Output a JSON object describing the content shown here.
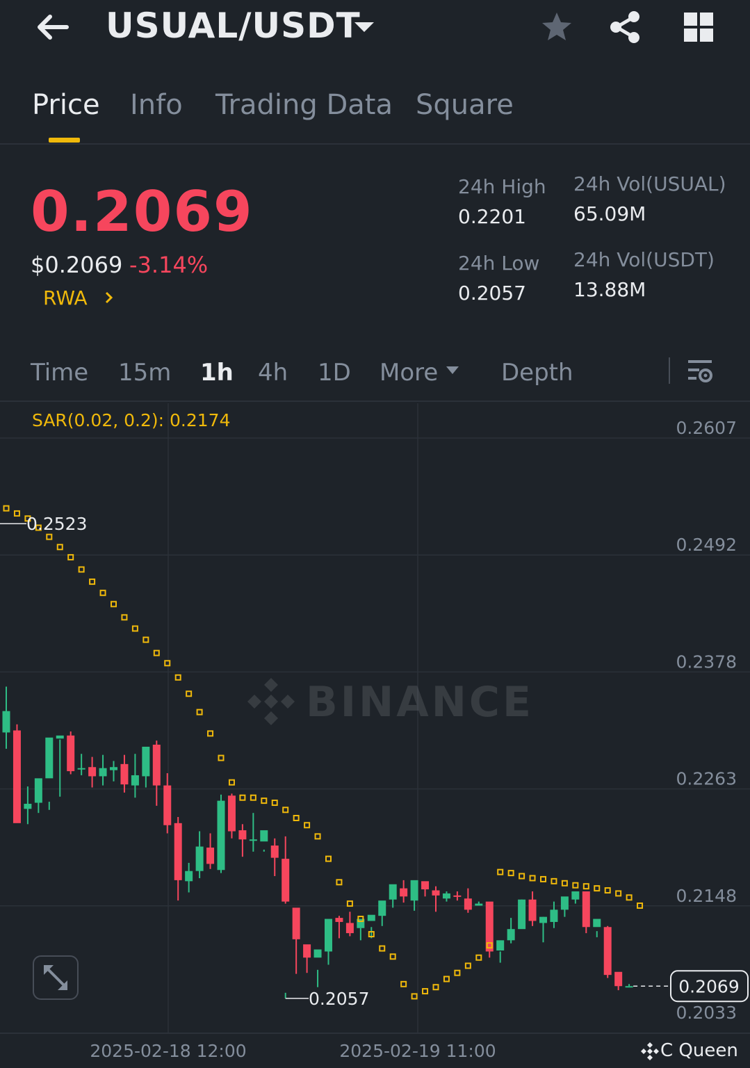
{
  "header": {
    "pair": "USUAL/USDT",
    "icons": [
      "back-arrow-icon",
      "caret-down-icon",
      "star-icon",
      "share-icon",
      "grid-icon"
    ]
  },
  "tabs": [
    {
      "label": "Price",
      "active": true
    },
    {
      "label": "Info",
      "active": false
    },
    {
      "label": "Trading Data",
      "active": false
    },
    {
      "label": "Square",
      "active": false
    }
  ],
  "ticker": {
    "last_price": "0.2069",
    "usd_price": "$0.2069",
    "change": "-3.14%",
    "tag": "RWA",
    "high_label": "24h High",
    "high_value": "0.2201",
    "low_label": "24h Low",
    "low_value": "0.2057",
    "vol_base_label": "24h Vol(USUAL)",
    "vol_base_value": "65.09M",
    "vol_quote_label": "24h Vol(USDT)",
    "vol_quote_value": "13.88M"
  },
  "intervals": [
    {
      "label": "Time",
      "active": false
    },
    {
      "label": "15m",
      "active": false
    },
    {
      "label": "1h",
      "active": true
    },
    {
      "label": "4h",
      "active": false
    },
    {
      "label": "1D",
      "active": false
    },
    {
      "label": "More",
      "active": false
    },
    {
      "label": "Depth",
      "active": false
    }
  ],
  "colors": {
    "up": "#2ebd85",
    "down": "#f6465d",
    "accent": "#f0b90b",
    "background": "#1e2329",
    "grid": "#2b3139",
    "muted": "#848e9c"
  },
  "chart_data": {
    "type": "candlestick",
    "indicator_label": "SAR(0.02, 0.2): 0.2174",
    "watermark": "BINANCE",
    "credit": "C Queen",
    "y_ticks": [
      "0.2607",
      "0.2492",
      "0.2378",
      "0.2263",
      "0.2148",
      "0.2033"
    ],
    "ylim": [
      0.2033,
      0.2607
    ],
    "x_ticks": [
      "2025-02-18 12:00",
      "2025-02-19 11:00"
    ],
    "max_marker": "0.2523",
    "min_marker": "0.2057",
    "last_price_label": "0.2069",
    "candles": [
      [
        0.2318,
        0.2363,
        0.2339,
        0.2302
      ],
      [
        0.232,
        0.2326,
        0.2229,
        0.2244
      ],
      [
        0.2243,
        0.2265,
        0.2248,
        0.2228
      ],
      [
        0.2249,
        0.225,
        0.2273,
        0.2239
      ],
      [
        0.2273,
        0.225,
        0.2313,
        0.2242
      ],
      [
        0.2312,
        0.2311,
        0.2315,
        0.2255
      ],
      [
        0.2315,
        0.2319,
        0.228,
        0.2277
      ],
      [
        0.2282,
        0.2297,
        0.2283,
        0.2276
      ],
      [
        0.2284,
        0.2294,
        0.2275,
        0.2264
      ],
      [
        0.2275,
        0.2296,
        0.2283,
        0.2266
      ],
      [
        0.2281,
        0.229,
        0.2284,
        0.227
      ],
      [
        0.2287,
        0.2296,
        0.2267,
        0.2259
      ],
      [
        0.2266,
        0.2297,
        0.2276,
        0.2254
      ],
      [
        0.2275,
        0.2295,
        0.2304,
        0.2264
      ],
      [
        0.2306,
        0.231,
        0.2266,
        0.2246
      ],
      [
        0.2266,
        0.2278,
        0.2227,
        0.2219
      ],
      [
        0.2229,
        0.2235,
        0.2173,
        0.2153
      ],
      [
        0.2172,
        0.219,
        0.2182,
        0.2161
      ],
      [
        0.2182,
        0.2221,
        0.2206,
        0.2175
      ],
      [
        0.2205,
        0.2219,
        0.2189,
        0.2184
      ],
      [
        0.2183,
        0.2257,
        0.2251,
        0.218
      ],
      [
        0.2256,
        0.2258,
        0.2221,
        0.2214
      ],
      [
        0.2222,
        0.2228,
        0.2213,
        0.2196
      ],
      [
        0.2213,
        0.2239,
        0.2213,
        0.2201
      ],
      [
        0.2211,
        0.2201,
        0.2222,
        0.2203
      ],
      [
        0.2207,
        0.2214,
        0.2195,
        0.2177
      ],
      [
        0.2194,
        0.2216,
        0.2152,
        0.215
      ],
      [
        0.2146,
        0.2138,
        0.2115,
        0.2081
      ],
      [
        0.211,
        0.2105,
        0.2097,
        0.2082
      ],
      [
        0.2097,
        0.2085,
        0.2105,
        0.2068
      ],
      [
        0.2103,
        0.2123,
        0.2135,
        0.209
      ],
      [
        0.2136,
        0.2138,
        0.2132,
        0.2116
      ],
      [
        0.2131,
        0.2142,
        0.2121,
        0.2118
      ],
      [
        0.2126,
        0.2126,
        0.2135,
        0.2114
      ],
      [
        0.2133,
        0.2127,
        0.2139,
        0.2116
      ],
      [
        0.2138,
        0.2147,
        0.2153,
        0.2128
      ],
      [
        0.2154,
        0.2157,
        0.2169,
        0.2146
      ],
      [
        0.2165,
        0.2173,
        0.2157,
        0.2151
      ],
      [
        0.2153,
        0.2163,
        0.2173,
        0.2143
      ],
      [
        0.2172,
        0.2169,
        0.2164,
        0.2157
      ],
      [
        0.2163,
        0.2167,
        0.2158,
        0.2142
      ],
      [
        0.2155,
        0.2162,
        0.216,
        0.2152
      ],
      [
        0.2158,
        0.2162,
        0.2157,
        0.2153
      ],
      [
        0.2155,
        0.2165,
        0.2144,
        0.2141
      ],
      [
        0.2148,
        0.2152,
        0.215,
        0.2148
      ],
      [
        0.2152,
        0.2151,
        0.2103,
        0.2097
      ],
      [
        0.2104,
        0.2103,
        0.2114,
        0.2092
      ],
      [
        0.2114,
        0.2136,
        0.2125,
        0.2111
      ],
      [
        0.2125,
        0.2154,
        0.2154,
        0.2135
      ],
      [
        0.2154,
        0.2162,
        0.2133,
        0.2128
      ],
      [
        0.2131,
        0.2137,
        0.2137,
        0.2112
      ],
      [
        0.2132,
        0.2152,
        0.2144,
        0.2126
      ],
      [
        0.2144,
        0.2149,
        0.2157,
        0.2137
      ],
      [
        0.2154,
        0.2155,
        0.2162,
        0.215
      ],
      [
        0.2162,
        0.2161,
        0.2127,
        0.2121
      ],
      [
        0.2127,
        0.2123,
        0.2135,
        0.2117
      ],
      [
        0.2127,
        0.2128,
        0.208,
        0.2077
      ],
      [
        0.2083,
        0.2081,
        0.2069,
        0.2065
      ],
      [
        0.2068,
        0.2071,
        0.2069,
        0.2069
      ]
    ],
    "sar": [
      0.2538,
      0.2533,
      0.2528,
      0.2519,
      0.251,
      0.25,
      0.249,
      0.2478,
      0.2466,
      0.2455,
      0.2444,
      0.2431,
      0.242,
      0.2409,
      0.2396,
      0.2386,
      0.2372,
      0.2356,
      0.2338,
      0.2317,
      0.2293,
      0.2269,
      0.2254,
      0.2254,
      0.2251,
      0.2249,
      0.2242,
      0.2234,
      0.2227,
      0.2216,
      0.2194,
      0.2171,
      0.215,
      0.2135,
      0.212,
      0.2106,
      0.2098,
      0.2071,
      0.2059,
      0.2064,
      0.2068,
      0.2076,
      0.2082,
      0.2089,
      0.2097,
      0.2109,
      0.2181,
      0.218,
      0.2177,
      0.2175,
      0.2174,
      0.2172,
      0.217,
      0.2168,
      0.2167,
      0.2165,
      0.2163,
      0.216,
      0.2156,
      0.2148
    ]
  }
}
